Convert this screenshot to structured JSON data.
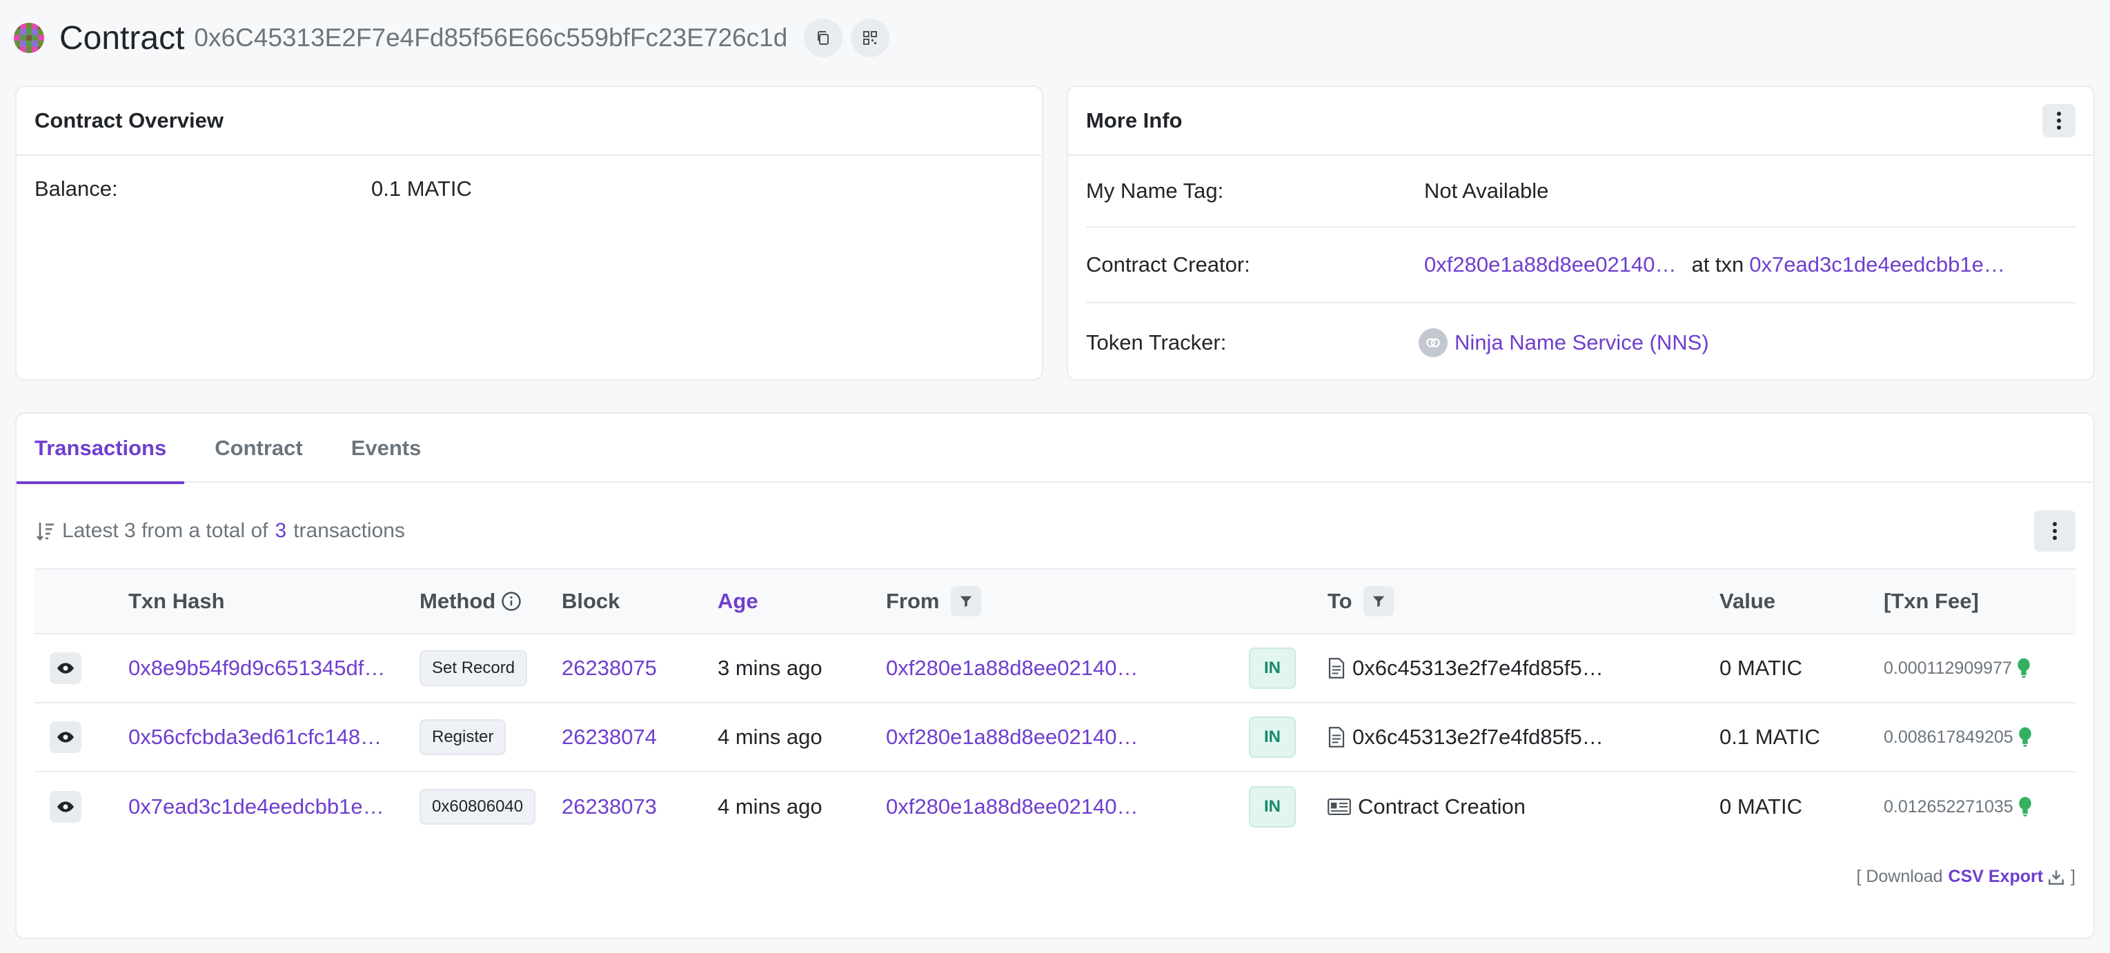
{
  "header": {
    "title": "Contract",
    "address": "0x6C45313E2F7e4Fd85f56E66c559bfFc23E726c1d",
    "copy_icon": "copy-icon",
    "qr_icon": "qr-code-icon"
  },
  "overview": {
    "title": "Contract Overview",
    "balance_label": "Balance:",
    "balance_value": "0.1 MATIC"
  },
  "more_info": {
    "title": "More Info",
    "name_tag_label": "My Name Tag:",
    "name_tag_value": "Not Available",
    "creator_label": "Contract Creator:",
    "creator_address": "0xf280e1a88d8ee02140…",
    "at_txn": "at txn",
    "creator_txn": "0x7ead3c1de4eedcbb1e…",
    "token_label": "Token Tracker:",
    "token_name": "Ninja Name Service (NNS)"
  },
  "tabs": [
    {
      "label": "Transactions"
    },
    {
      "label": "Contract"
    },
    {
      "label": "Events"
    }
  ],
  "summary": {
    "prefix": "Latest 3 from a total of",
    "count": "3",
    "suffix": "transactions"
  },
  "table": {
    "headers": {
      "hash": "Txn Hash",
      "method": "Method",
      "block": "Block",
      "age": "Age",
      "from": "From",
      "to": "To",
      "value": "Value",
      "fee": "[Txn Fee]"
    },
    "rows": [
      {
        "hash": "0x8e9b54f9d9c651345df…",
        "method": "Set Record",
        "block": "26238075",
        "age": "3 mins ago",
        "from": "0xf280e1a88d8ee02140…",
        "direction": "IN",
        "to": "0x6c45313e2f7e4fd85f5…",
        "to_icon": "contract-file-icon",
        "value": "0 MATIC",
        "fee": "0.000112909977"
      },
      {
        "hash": "0x56cfcbda3ed61cfc148…",
        "method": "Register",
        "block": "26238074",
        "age": "4 mins ago",
        "from": "0xf280e1a88d8ee02140…",
        "direction": "IN",
        "to": "0x6c45313e2f7e4fd85f5…",
        "to_icon": "contract-file-icon",
        "value": "0.1 MATIC",
        "fee": "0.008617849205"
      },
      {
        "hash": "0x7ead3c1de4eedcbb1e…",
        "method": "0x60806040",
        "block": "26238073",
        "age": "4 mins ago",
        "from": "0xf280e1a88d8ee02140…",
        "direction": "IN",
        "to": "Contract Creation",
        "to_icon": "contract-creation-icon",
        "value": "0 MATIC",
        "fee": "0.012652271035"
      }
    ]
  },
  "download": {
    "open": "[ Download",
    "link": "CSV Export",
    "close": "]"
  },
  "colors": {
    "accent": "#6f3ecf",
    "in_badge": "#15896a",
    "fee_bulb": "#34b060"
  }
}
